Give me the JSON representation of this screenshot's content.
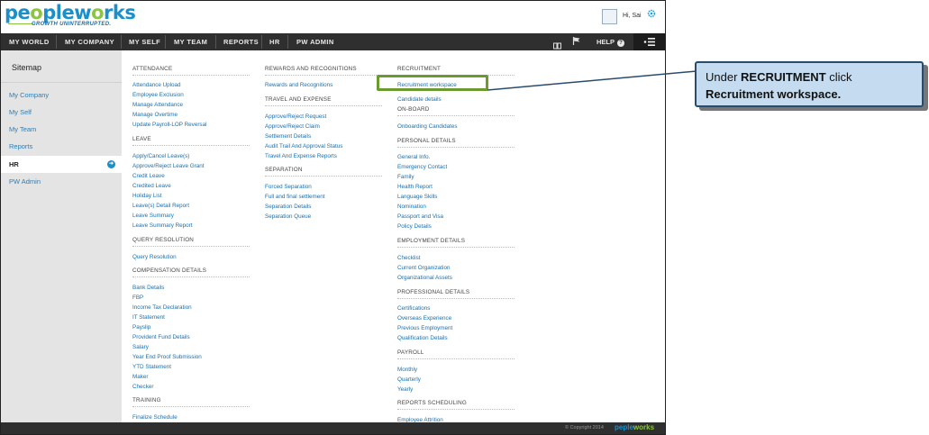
{
  "header": {
    "logo_text_a": "pe",
    "logo_text_b": "o",
    "logo_text_c": "ple",
    "logo_text_d": "w",
    "logo_text_e": "o",
    "logo_text_f": "rks",
    "tagline": "GROWTH UNINTERRUPTED.",
    "greeting": "Hi, Sai"
  },
  "nav": {
    "items": [
      "MY WORLD",
      "MY COMPANY",
      "MY SELF",
      "MY TEAM",
      "REPORTS",
      "HR",
      "PW ADMIN"
    ],
    "help": "HELP"
  },
  "sidebar": {
    "title": "Sitemap",
    "items": [
      "My Company",
      "My Self",
      "My Team",
      "Reports",
      "HR",
      "PW Admin"
    ],
    "active": "HR"
  },
  "col1": {
    "attendance_title": "ATTENDANCE",
    "attendance": [
      "Attendance Upload",
      "Employee Exclusion",
      "Manage Attendance",
      "Manage Overtime",
      "Update Payroll-LOP Reversal"
    ],
    "leave_title": "LEAVE",
    "leave": [
      "Apply/Cancel Leave(s)",
      "Approve/Reject Leave Grant",
      "Credit Leave",
      "Credited Leave",
      "Holiday List",
      "Leave(s) Detail Report",
      "Leave Summary",
      "Leave Summary Report"
    ],
    "query_title": "QUERY RESOLUTION",
    "query": [
      "Query Resolution"
    ],
    "comp_title": "COMPENSATION DETAILS",
    "comp": [
      "Bank Details",
      "FBP",
      "Income Tax Declaration",
      "IT Statement",
      "Payslip",
      "Provident Fund Details",
      "Salary",
      "Year End Proof Submission",
      "YTD Statement",
      "Maker",
      "Checker"
    ],
    "training_title": "TRAINING",
    "training": [
      "Finalize Schedule"
    ]
  },
  "col2": {
    "rewards_title": "REWARDS AND RECOGNITIONS",
    "rewards": [
      "Rewards and Recognitions"
    ],
    "travel_title": "TRAVEL AND EXPENSE",
    "travel": [
      "Approve/Reject Request",
      "Approve/Reject Claim",
      "Settlement Details",
      "Audit Trail And Approval Status",
      "Travel And Expense Reports"
    ],
    "separation_title": "SEPARATION",
    "separation": [
      "Forced Separation",
      "Full and final settlement",
      "Separation Details",
      "Separation Queue"
    ]
  },
  "col3": {
    "recruitment_title": "RECRUITMENT",
    "recruitment": [
      "Recruitment workspace",
      "Candidate details"
    ],
    "onboard_title": "ON-BOARD",
    "onboard": [
      "Onboarding Candidates"
    ],
    "personal_title": "PERSONAL DETAILS",
    "personal": [
      "General Info.",
      "Emergency Contact",
      "Family",
      "Health Report",
      "Language Skills",
      "Nomination",
      "Passport and Visa",
      "Policy Details"
    ],
    "employment_title": "EMPLOYMENT DETAILS",
    "employment": [
      "Checklist",
      "Current Organization",
      "Organizational Assets"
    ],
    "professional_title": "PROFESSIONAL DETAILS",
    "professional": [
      "Certifications",
      "Overseas Experience",
      "Previous Employment",
      "Qualification Details"
    ],
    "payroll_title": "PAYROLL",
    "payroll": [
      "Monthly",
      "Quarterly",
      "Yearly"
    ],
    "reports_title": "REPORTS SCHEDULING",
    "reports": [
      "Employee Attrition"
    ]
  },
  "footer": {
    "copyright": "© Copyright 2014",
    "logo_a": "peple",
    "logo_b": "works"
  },
  "callout": {
    "pre": "Under ",
    "bold1": "RECRUITMENT",
    "mid": " click",
    "bold2": "Recruitment workspace."
  },
  "colors": {
    "accent": "#1a8fc9",
    "nav_bg": "#2f2f2f",
    "highlight": "#6a9a30",
    "callout_bg": "#c5dcf0"
  }
}
